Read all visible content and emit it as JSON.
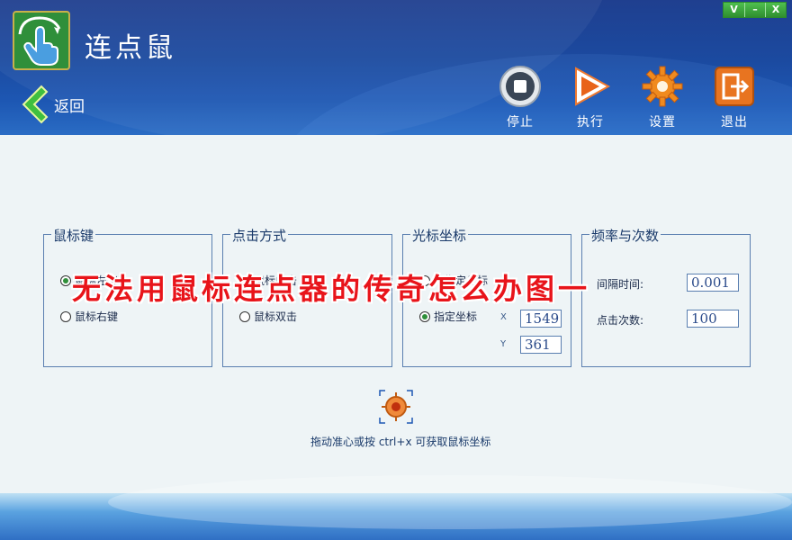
{
  "window": {
    "title": "连点鼠",
    "controls": [
      "V",
      "–",
      "X"
    ]
  },
  "nav": {
    "back_label": "返回"
  },
  "toolbar": {
    "stop_label": "停止",
    "run_label": "执行",
    "settings_label": "设置",
    "exit_label": "退出"
  },
  "groups": {
    "mouse_key": {
      "title": "鼠标键",
      "option_left": "鼠标左键",
      "option_right": "鼠标右键",
      "selected": "left"
    },
    "click_mode": {
      "title": "点击方式",
      "option_single": "鼠标单击",
      "option_double": "鼠标双击",
      "selected": "single"
    },
    "cursor": {
      "title": "光标坐标",
      "option_free": "不指定坐标",
      "option_fixed": "指定坐标",
      "selected": "fixed",
      "x_label": "X",
      "x_value": "1549",
      "y_label": "Y",
      "y_value": "361"
    },
    "frequency": {
      "title": "频率与次数",
      "interval_label": "间隔时间:",
      "interval_value": "0.001",
      "count_label": "点击次数:",
      "count_value": "100"
    }
  },
  "hint": "拖动准心或按 ctrl+x 可获取鼠标坐标",
  "overlay_text": "无法用鼠标连点器的传奇怎么办图一",
  "icons": {
    "logo": "hand-pointer-icon",
    "back": "chevron-left-icon",
    "stop": "stop-icon",
    "run": "play-icon",
    "settings": "gear-icon",
    "exit": "exit-icon",
    "crosshair": "crosshair-icon"
  },
  "colors": {
    "header": "#1d57b3",
    "accent_green": "#2f8f3a",
    "overlay_red": "#e8141a",
    "border": "#5a7fb0"
  }
}
